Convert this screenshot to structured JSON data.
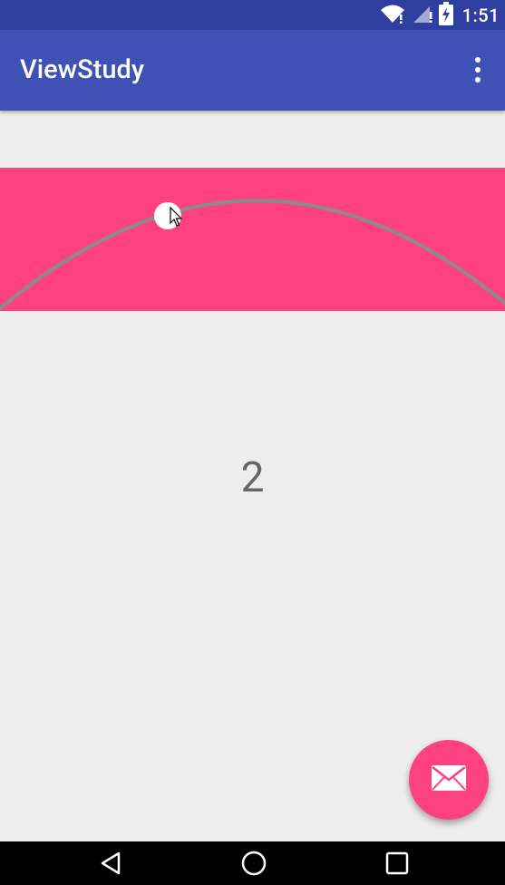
{
  "status_bar": {
    "time": "1:51",
    "icons": [
      "wifi-icon",
      "cell-signal-icon",
      "battery-charging-icon"
    ]
  },
  "app_bar": {
    "title": "ViewStudy",
    "overflow_icon": "more-vert-icon"
  },
  "content": {
    "page_number": "2"
  },
  "colors": {
    "status_bar": "#303f9f",
    "app_bar": "#3f51b5",
    "accent": "#ff4081",
    "background": "#eeeeee",
    "arc": "#8c8c8c"
  },
  "fab": {
    "icon": "email-icon"
  },
  "nav_bar": {
    "icons": [
      "back-icon",
      "home-icon",
      "recents-icon"
    ]
  }
}
